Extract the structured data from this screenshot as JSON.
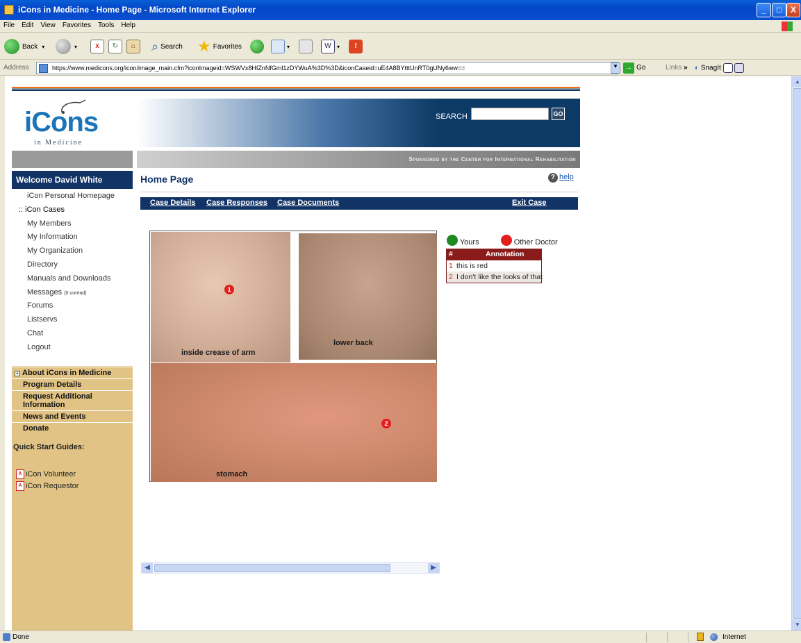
{
  "window": {
    "title": "iCons in Medicine - Home Page - Microsoft Internet Explorer",
    "minimize": "_",
    "maximize": "□",
    "close": "X"
  },
  "menu": [
    "File",
    "Edit",
    "View",
    "Favorites",
    "Tools",
    "Help"
  ],
  "toolbar": {
    "back": "Back",
    "search": "Search",
    "favorites": "Favorites"
  },
  "address": {
    "label": "Address",
    "url": "https://www.medicons.org/icon/image_main.cfm?iconImageid=WSWVx8HIZnNfGml1zDYWuA%3D%3D&iconCaseid=uE4A8BYtttUnRT0gUNy6ww==",
    "go": "Go",
    "links": "Links",
    "chevron": "»",
    "snagit": "SnagIt"
  },
  "site": {
    "logo_text": "iCons",
    "logo_sub": "in Medicine",
    "search_label": "SEARCH",
    "search_value": "",
    "search_go": "GO",
    "sponsor": "Sponsored by the Center for International Rehabilitation"
  },
  "sidebar": {
    "welcome": "Welcome David White",
    "nav": [
      {
        "label": "iCon Personal Homepage"
      },
      {
        "label": ":: iCon Cases",
        "active": true
      },
      {
        "label": "My Members"
      },
      {
        "label": "My Information"
      },
      {
        "label": "My Organization"
      },
      {
        "label": "Directory"
      },
      {
        "label": "Manuals and Downloads"
      },
      {
        "label": "Messages",
        "extra": "(0 unread)"
      },
      {
        "label": "Forums"
      },
      {
        "label": "Listservs"
      },
      {
        "label": "Chat"
      },
      {
        "label": "Logout"
      }
    ],
    "sections": [
      "About iCons in Medicine",
      "Program Details",
      "Request Additional Information",
      "News and Events",
      "Donate"
    ],
    "quick_start_title": "Quick Start Guides:",
    "quick_start": [
      "iCon Volunteer",
      "iCon Requestor"
    ]
  },
  "main": {
    "page_title": "Home Page",
    "help": "help",
    "case_nav": {
      "details": "Case Details",
      "responses": "Case Responses",
      "documents": "Case Documents",
      "exit": "Exit Case"
    },
    "photos": [
      {
        "caption": "inside crease of arm",
        "marker": "1"
      },
      {
        "caption": "lower back"
      },
      {
        "caption": "stomach",
        "marker": "2"
      }
    ],
    "legend": {
      "yours": "Yours",
      "other": "Other Doctor",
      "yours_color": "#1f8a1f",
      "other_color": "#e21f1f"
    },
    "annotations": {
      "col_num": "#",
      "col_text": "Annotation",
      "rows": [
        {
          "n": "1",
          "text": "this is red"
        },
        {
          "n": "2",
          "text": "I don't like the looks of that"
        }
      ]
    }
  },
  "status": {
    "text": "Done",
    "zone": "Internet"
  }
}
